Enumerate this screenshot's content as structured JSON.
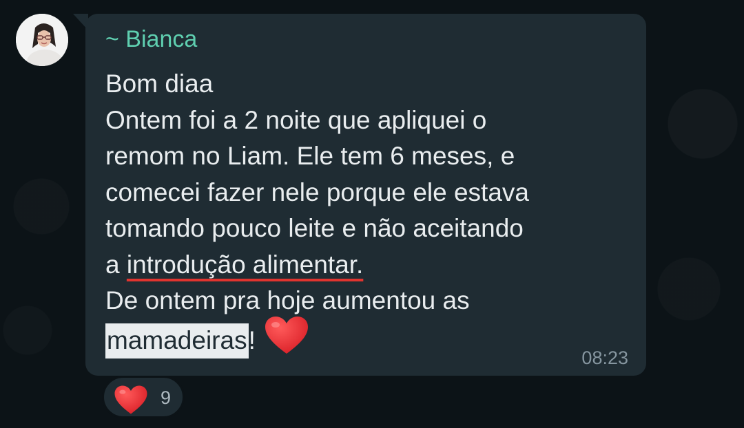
{
  "message": {
    "sender": "~ Bianca",
    "lines": [
      "Bom diaa",
      "Ontem foi a 2 noite que apliquei o",
      "remom no Liam. Ele tem 6 meses, e",
      "comecei fazer nele porque ele estava",
      "tomando pouco leite e não aceitando"
    ],
    "line6_prefix": "a ",
    "line6_underlined": "introdução alimentar.",
    "line7": "De ontem pra hoje aumentou as",
    "line8_highlighted": "mamadeiras",
    "line8_suffix": "!",
    "emoji": "red-heart-emoji",
    "timestamp": "08:23"
  },
  "reaction": {
    "emoji": "red-heart-emoji",
    "count": "9"
  },
  "colors": {
    "background": "#0c1317",
    "bubble": "#1f2c33",
    "sender_name": "#5fcfb0",
    "text": "#e9edef",
    "timestamp": "#8696a0",
    "underline": "#e0342f",
    "heart": "#e0242b"
  }
}
